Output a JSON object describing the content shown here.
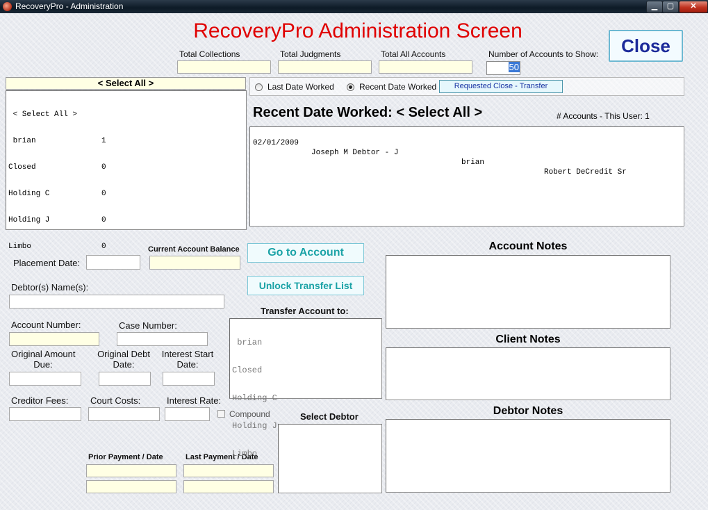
{
  "window": {
    "title": "RecoveryPro - Administration",
    "min_glyph": "▁",
    "max_glyph": "▢",
    "close_glyph": "✕"
  },
  "header": {
    "title": "RecoveryPro Administration Screen",
    "close_label": "Close"
  },
  "totals": {
    "collections_label": "Total Collections",
    "collections_value": "",
    "judgments_label": "Total Judgments",
    "judgments_value": "",
    "all_accounts_label": "Total All Accounts",
    "all_accounts_value": "",
    "num_show_label": "Number of Accounts to Show:",
    "num_show_value": "50"
  },
  "user_panel": {
    "header": "< Select All >",
    "items": [
      {
        "name": " < Select All >",
        "count": ""
      },
      {
        "name": " brian",
        "count": "1"
      },
      {
        "name": "Closed",
        "count": "0"
      },
      {
        "name": "Holding C",
        "count": "0"
      },
      {
        "name": "Holding J",
        "count": "0"
      },
      {
        "name": "Limbo",
        "count": "0"
      }
    ]
  },
  "options": {
    "last_date_label": "Last Date Worked",
    "recent_date_label": "Recent Date Worked",
    "selected": "recent",
    "requested_close_label": "Requested Close - Transfer"
  },
  "accounts": {
    "heading": "Recent Date Worked:  < Select All >",
    "count_label": "# Accounts - This User:  1",
    "rows": [
      {
        "date": "02/01/2009",
        "debtor": "Joseph M Debtor - J",
        "user": "brian",
        "creditor": "Robert DeCredit Sr"
      }
    ]
  },
  "account_form": {
    "placement_date_label": "Placement Date:",
    "current_balance_label": "Current Account Balance",
    "debtor_names_label": "Debtor(s) Name(s):",
    "account_number_label": "Account Number:",
    "case_number_label": "Case Number:",
    "original_amount_label": "Original Amount",
    "original_amount_label2": "Due:",
    "original_debt_label": "Original Debt",
    "original_debt_label2": "Date:",
    "interest_start_label": "Interest Start",
    "interest_start_label2": "Date:",
    "creditor_fees_label": "Creditor Fees:",
    "court_costs_label": "Court Costs:",
    "interest_rate_label": "Interest Rate:",
    "compound_label": "Compound",
    "prior_payment_label": "Prior Payment / Date",
    "last_payment_label": "Last Payment / Date"
  },
  "actions": {
    "goto_label": "Go to Account",
    "unlock_label": "Unlock Transfer List"
  },
  "transfer": {
    "label": "Transfer Account to:",
    "items": [
      " brian",
      "Closed",
      "Holding C",
      "Holding J",
      "Limbo"
    ]
  },
  "debtor_select_label": "Select Debtor",
  "notes": {
    "account_label": "Account Notes",
    "client_label": "Client Notes",
    "debtor_label": "Debtor Notes"
  }
}
